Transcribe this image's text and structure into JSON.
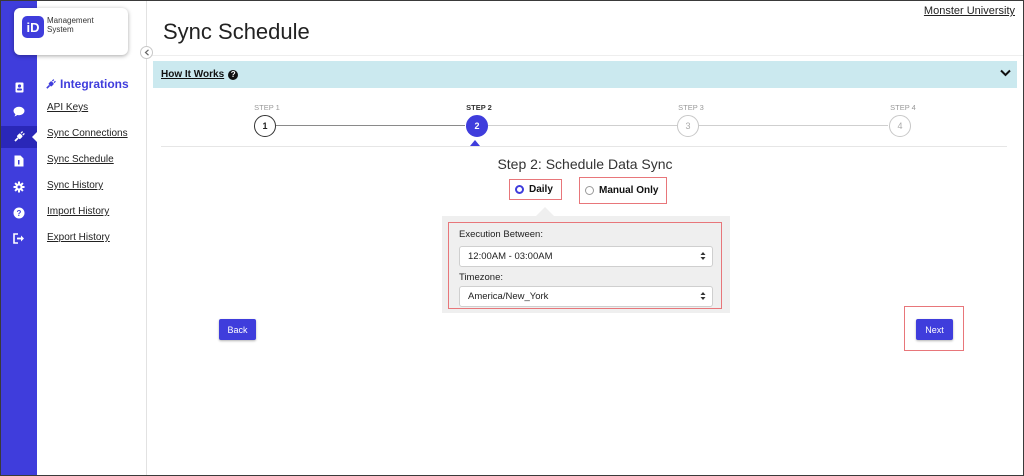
{
  "brand": {
    "logo_letters": "iD",
    "line1": "Management",
    "line2": "System"
  },
  "org_link": "Monster University",
  "page_title": "Sync Schedule",
  "how_it_works": {
    "label": "How It Works",
    "help_glyph": "?"
  },
  "rail": {
    "icons": [
      "contacts-icon",
      "chat-icon",
      "plug-icon",
      "document-icon",
      "gear-icon",
      "help-icon",
      "sign-out-icon"
    ],
    "active_index": 2,
    "accent_color": "#3f3ddc"
  },
  "subnav": {
    "title": "Integrations",
    "items": [
      {
        "label": "API Keys"
      },
      {
        "label": "Sync Connections"
      },
      {
        "label": "Sync Schedule"
      },
      {
        "label": "Sync History"
      },
      {
        "label": "Import History"
      },
      {
        "label": "Export History"
      }
    ]
  },
  "stepper": {
    "current": 2,
    "steps": [
      {
        "label": "STEP 1",
        "number": "1",
        "state": "done"
      },
      {
        "label": "STEP 2",
        "number": "2",
        "state": "current"
      },
      {
        "label": "STEP 3",
        "number": "3",
        "state": "upcoming"
      },
      {
        "label": "STEP 4",
        "number": "4",
        "state": "upcoming"
      }
    ]
  },
  "step_heading": "Step 2: Schedule Data Sync",
  "options": {
    "daily": {
      "label": "Daily",
      "selected": true
    },
    "manual": {
      "label": "Manual Only",
      "selected": false
    }
  },
  "form": {
    "execution_label": "Execution Between:",
    "execution_value": "12:00AM - 03:00AM",
    "timezone_label": "Timezone:",
    "timezone_value": "America/New_York"
  },
  "buttons": {
    "back": "Back",
    "next": "Next"
  },
  "colors": {
    "accent": "#3f3ddc",
    "info_bar": "#cbe9ef",
    "highlight": "#e8767a"
  }
}
